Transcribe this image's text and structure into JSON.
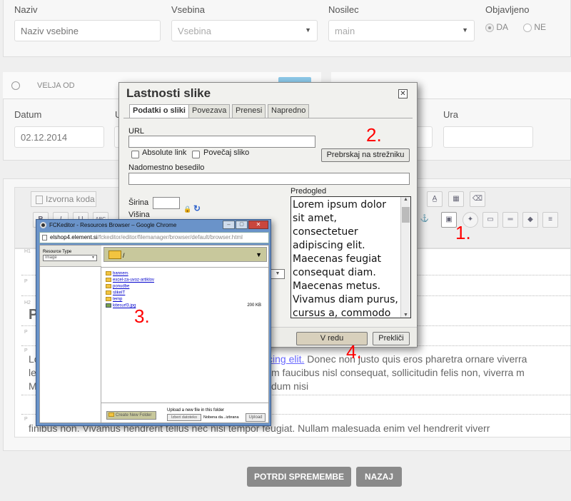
{
  "top_form": {
    "naziv_label": "Naziv",
    "naziv_placeholder": "Naziv vsebine",
    "vsebina_label": "Vsebina",
    "vsebina_value": "Vsebina",
    "nosilec_label": "Nosilec",
    "nosilec_value": "main",
    "objavljeno_label": "Objavljeno",
    "radio_da": "DA",
    "radio_ne": "NE"
  },
  "validity": {
    "header": "VELJA OD",
    "datum_label": "Datum",
    "datum_value": "02.12.2014",
    "ura_label": "Ura"
  },
  "toolbar": {
    "source_label": "Izvorna koda"
  },
  "editor": {
    "heading_letter": "P",
    "link_text": "cing elit.",
    "line1_start": "Lo",
    "line1_end": " Donec non justo quis eros pharetra ornare viverra",
    "line2_start": "le",
    "line2_end": "m faucibus nisl consequat, sollicitudin felis non, viverra m",
    "line3_start": "M",
    "line3_end": "dum nisi",
    "line4": "finibus non. Vivamus hendrerit tellus nec nisi tempor feugiat. Nullam malesuada enim vel hendrerit viverr",
    "marks": [
      "H1",
      "P",
      "H2",
      "P",
      "P",
      "P"
    ]
  },
  "dialog": {
    "title": "Lastnosti slike",
    "tabs": [
      "Podatki o sliki",
      "Povezava",
      "Prenesi",
      "Napredno"
    ],
    "url_label": "URL",
    "absolute_link": "Absolute link",
    "enlarge": "Povečaj sliko",
    "browse_server": "Prebrskaj na strežniku",
    "alt_label": "Nadomestno besedilo",
    "width_label": "Širina",
    "height_label": "Višina",
    "preview_label": "Predogled",
    "preview_text": "Lorem ipsum dolor sit amet, consectetuer adipiscing elit. Maecenas feugiat consequat diam. Maecenas metus. Vivamus diam purus, cursus a, commodo",
    "ok": "V redu",
    "cancel": "Prekliči"
  },
  "browser": {
    "title": "FCKeditor - Resources Browser – Google Chrome",
    "address_host": "elshop4.element.si",
    "address_path": "/fckeditor/editor/filemanager/browser/default/browser.html",
    "resource_type_label": "Resource Type",
    "resource_type_value": "Image",
    "current_folder": "/",
    "folders": [
      "banners",
      "excel-za-uvoz-artiklov",
      "ponudbe",
      "slikeIT",
      "temp"
    ],
    "file_name": "kitesurf3.jpg",
    "file_size": "200 KB",
    "create_folder": "Create New Folder",
    "upload_label": "Upload a new file in this folder",
    "choose_file": "Izberi datoteko",
    "no_file": "Nobena da...izbrana",
    "upload_button": "Upload"
  },
  "annotations": [
    "1.",
    "2.",
    "3.",
    "4."
  ],
  "buttons": {
    "confirm": "POTRDI SPREMEMBE",
    "back": "NAZAJ"
  },
  "colors": {
    "annotation": "#ff0000",
    "dark_button": "#8a8a8a",
    "folder_bar": "#c8c89c"
  }
}
